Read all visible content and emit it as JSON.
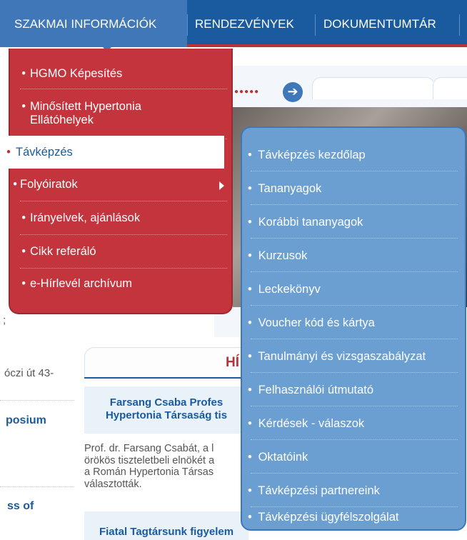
{
  "topnav": {
    "tabs": [
      {
        "label": "SZAKMAI INFORMÁCIÓK",
        "active": true
      },
      {
        "label": "RENDEZVÉNYEK",
        "active": false
      },
      {
        "label": "DOKUMENTUMTÁR",
        "active": false
      }
    ]
  },
  "menu": {
    "items": [
      {
        "label": "HGMO Képesítés"
      },
      {
        "label": "Minősített Hypertonia Ellátóhelyek"
      },
      {
        "label": "Távképzés",
        "active": true
      },
      {
        "label": "Folyóiratok",
        "has_submenu": true
      },
      {
        "label": "Irányelvek, ajánlások"
      },
      {
        "label": "Cikk referáló"
      },
      {
        "label": "e-Hírlevél archívum"
      }
    ]
  },
  "submenu": {
    "items": [
      {
        "label": "Távképzés kezdőlap"
      },
      {
        "label": "Tananyagok"
      },
      {
        "label": "Korábbi tananyagok"
      },
      {
        "label": "Kurzusok"
      },
      {
        "label": "Leckekönyv"
      },
      {
        "label": "Voucher kód és kártya"
      },
      {
        "label": "Tanulmányi és vizsgaszabályzat"
      },
      {
        "label": "Felhasználói útmutató"
      },
      {
        "label": "Kérdések - válaszok"
      },
      {
        "label": "Oktatóink"
      },
      {
        "label": "Távképzési partnereink"
      },
      {
        "label": "Távképzési ügyfélszolgálat"
      }
    ]
  },
  "background": {
    "news_header": "HÍ",
    "left_text_1": "óczi út 43-",
    "left_link_1": "posium",
    "left_link_2": "ss of",
    "left_small": ";",
    "news_1_title_line1": "Farsang Csaba Profes",
    "news_1_title_line2": "Hypertonia Társaság tis",
    "news_1_body": "Prof. dr. Farsang Csabát, a l\nörökös tiszteletbeli elnökét a\na Román Hypertonia Társas\nválasztották.",
    "news_2_title": "Fiatal Tagtársunk figyelem"
  },
  "colors": {
    "nav_blue": "#1a5a9e",
    "menu_red": "#c3343c",
    "submenu_blue": "#6b9fd2"
  },
  "icons": {
    "slider_next": "arrow-right-icon",
    "submenu_caret": "caret-right-icon"
  }
}
